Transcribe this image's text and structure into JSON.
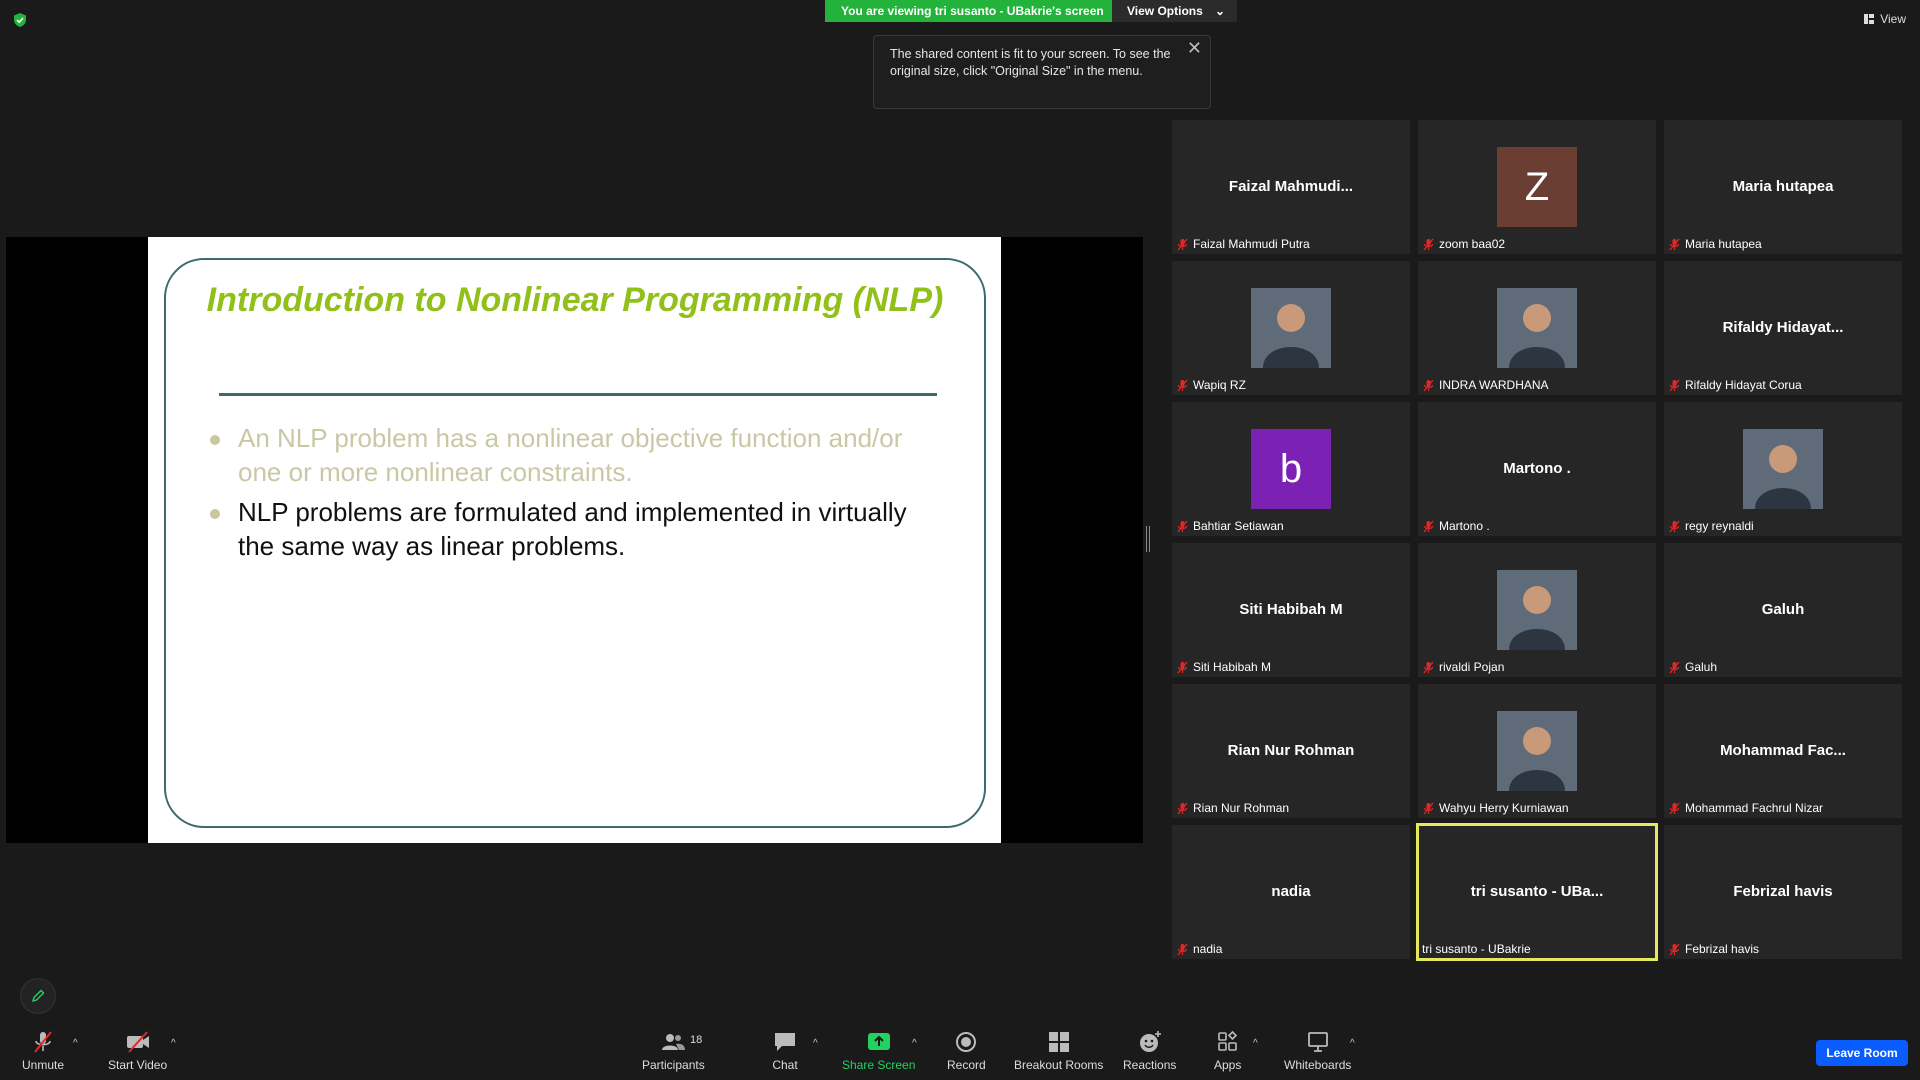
{
  "banner": {
    "viewing_text": "You are viewing tri susanto - UBakrie's screen",
    "view_options": "View Options"
  },
  "top_right": {
    "view_label": "View"
  },
  "tooltip": {
    "text": "The shared content is fit to your screen. To see the original size, click \"Original Size\" in the menu."
  },
  "slide": {
    "title": "Introduction to Nonlinear Programming (NLP)",
    "bullets": [
      "An NLP problem has a nonlinear objective function and/or one or more nonlinear constraints.",
      "NLP problems are formulated and implemented in virtually the same way as linear problems."
    ]
  },
  "participants": [
    {
      "center": "Faizal  Mahmudi...",
      "label": "Faizal Mahmudi Putra"
    },
    {
      "avatar": "Z",
      "label": "zoom baa02",
      "color": "#6b3e34"
    },
    {
      "center": "Maria hutapea",
      "label": "Maria hutapea"
    },
    {
      "photo": "photo-person-icon",
      "label": "Wapiq RZ"
    },
    {
      "photo": "photo-person-icon",
      "label": "INDRA WARDHANA"
    },
    {
      "center": "Rifaldy  Hidayat...",
      "label": "Rifaldy Hidayat Corua"
    },
    {
      "avatar": "b",
      "label": "Bahtiar Setiawan",
      "color": "#7b22b5"
    },
    {
      "center": "Martono .",
      "label": "Martono ."
    },
    {
      "photo": "photo-person-icon",
      "label": "regy reynaldi"
    },
    {
      "center": "Siti Habibah M",
      "label": "Siti Habibah M"
    },
    {
      "photo": "photo-person-icon",
      "label": "rivaldi Pojan"
    },
    {
      "center": "Galuh",
      "label": "Galuh"
    },
    {
      "center": "Rian Nur Rohman",
      "label": "Rian Nur Rohman"
    },
    {
      "photo": "photo-person-icon",
      "label": "Wahyu Herry Kurniawan"
    },
    {
      "center": "Mohammad  Fac...",
      "label": "Mohammad Fachrul Nizar"
    },
    {
      "center": "nadia",
      "label": "nadia"
    },
    {
      "center": "tri susanto - UBa...",
      "label": "tri susanto - UBakrie",
      "active": true
    },
    {
      "center": "Febrizal havis",
      "label": "Febrizal havis"
    }
  ],
  "toolbar": {
    "unmute": "Unmute",
    "start_video": "Start Video",
    "participants": "Participants",
    "participants_count": "18",
    "chat": "Chat",
    "share_screen": "Share Screen",
    "record": "Record",
    "breakout_rooms": "Breakout Rooms",
    "reactions": "Reactions",
    "apps": "Apps",
    "whiteboards": "Whiteboards",
    "leave_room": "Leave Room"
  },
  "colors": {
    "share_green": "#23b33a",
    "active_speaker": "#e3e85c",
    "leave_blue": "#0b5cff",
    "slide_title": "#92c01b"
  }
}
